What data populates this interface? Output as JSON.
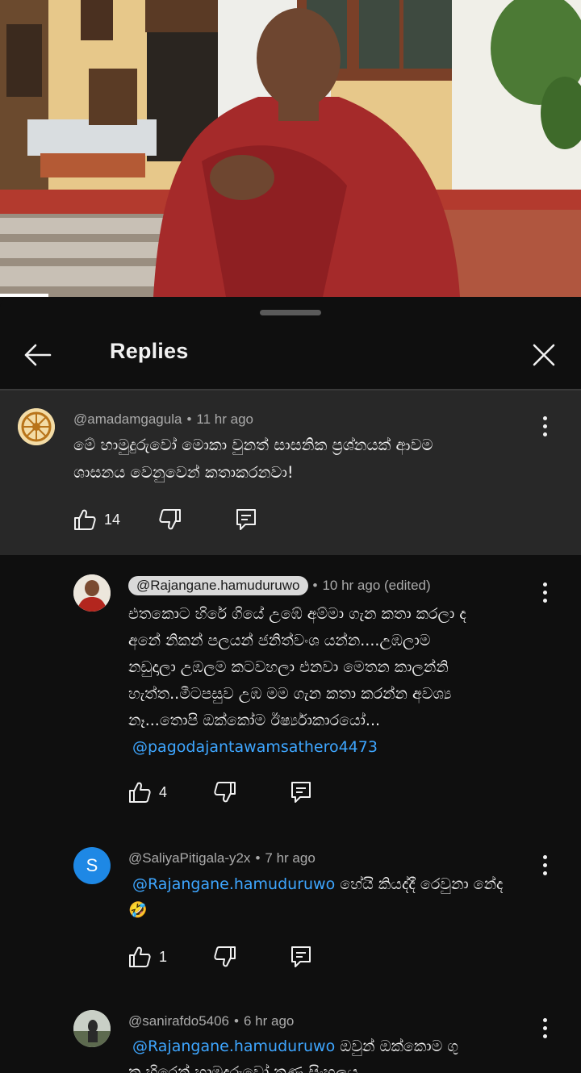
{
  "header": {
    "title": "Replies"
  },
  "parent_comment": {
    "author": "@amadamgagula",
    "time": "11 hr ago",
    "lines": [
      "මේ හාමුදුරුවෝ මොකා වුනත් සාසනික ප්‍රශ්නයක් ආවම",
      "ශාසනය වෙනුවෙන් කතාකරනවා!"
    ],
    "likes": "14"
  },
  "replies": [
    {
      "author": "@Rajangane.hamuduruwo",
      "time": "10 hr ago (edited)",
      "lines": [
        "එතකොට හිරේ ගියේ උඹේ අම්මා ගැන කතා කරලා ද",
        "අනේ නිකන් පලයන් ජනිත්වංශ යන්න....උඹලාම",
        "නඩුදාලා උඹලම කටවහලා එනවා මෙතන කාලන්නි",
        "හැත්ත..මීටපසුව උඹ මම ගැන කතා කරන්න අවශ්‍ය",
        "නෑ...තොපි ඔක්කෝම ඊර්ෂ්‍යාකාරයෝ..."
      ],
      "mention": "@pagodajantawamsathero4473",
      "likes": "4"
    },
    {
      "author": "@SaliyaPitigala-y2x",
      "time": "7 hr ago",
      "avatar_letter": "S",
      "mention": "@Rajangane.hamuduruwo",
      "text": "හේයි කියද්දී රෙවුනා නේද",
      "emoji": "🤣",
      "likes": "1"
    },
    {
      "author": "@sanirafdo5406",
      "time": "6 hr ago",
      "mention": "@Rajangane.hamuduruwo",
      "text": "ඔවුන් ඔක්කොම ගු",
      "text2": "කු හිරෙන් හාමුදුරුවෝ තුණු සිංහලය"
    }
  ],
  "colors": {
    "background": "#0f0f0f",
    "parent_bg": "#282828",
    "mention": "#3ea6ff",
    "avatar_s": "#1e88e5"
  }
}
